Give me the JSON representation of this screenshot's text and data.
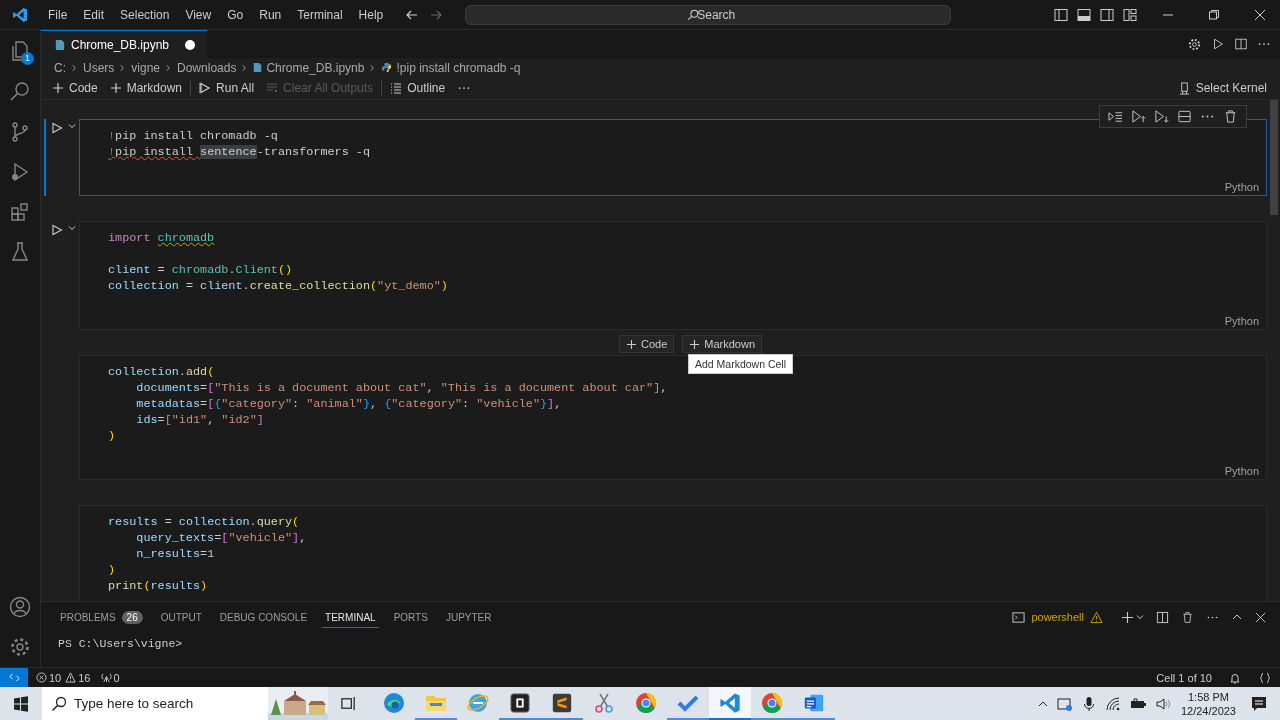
{
  "title_bar": {
    "menus": [
      "File",
      "Edit",
      "Selection",
      "View",
      "Go",
      "Run",
      "Terminal",
      "Help"
    ],
    "search": {
      "placeholder": "Search"
    }
  },
  "activity_bar": {
    "explorer_badge": "1"
  },
  "editor_tab": {
    "label": "Chrome_DB.ipynb",
    "dirty": true
  },
  "breadcrumb": [
    "C:",
    "Users",
    "vigne",
    "Downloads",
    "Chrome_DB.ipynb",
    "!pip install chromadb -q"
  ],
  "notebook_toolbar": {
    "items": [
      {
        "label": "Code",
        "kind": "plus",
        "disabled": false
      },
      {
        "label": "Markdown",
        "kind": "plus",
        "disabled": false
      },
      {
        "label": "Run All",
        "kind": "run",
        "disabled": false
      },
      {
        "label": "Clear All Outputs",
        "kind": "clear",
        "disabled": true
      },
      {
        "label": "Outline",
        "kind": "outline",
        "disabled": false
      }
    ],
    "kernel": "Select Kernel"
  },
  "cells": [
    {
      "selected": true,
      "run_visible": true,
      "language": "Python",
      "lines": [
        {
          "tokens": [
            {
              "text": "!",
              "kind": "bang"
            },
            {
              "text": "pip install chromadb -q",
              "kind": "plain"
            }
          ]
        },
        {
          "tokens": [
            {
              "text": "!",
              "kind": "bang_error"
            },
            {
              "text": "pip install ",
              "kind": "error"
            },
            {
              "text": "sentence",
              "kind": "highlight"
            },
            {
              "text": "-transformers -q",
              "kind": "plain"
            }
          ]
        }
      ]
    },
    {
      "selected": false,
      "run_visible": true,
      "language": "Python",
      "lines": [
        {
          "tokens": [
            {
              "text": "import ",
              "kind": "keyword"
            },
            {
              "text": "chromadb",
              "kind": "module_warning"
            }
          ]
        },
        {
          "blank_before": true,
          "tokens": [
            {
              "text": "client",
              "kind": "variable"
            },
            {
              "text": " = ",
              "kind": "plain"
            },
            {
              "text": "chromadb",
              "kind": "module"
            },
            {
              "text": ".",
              "kind": "plain"
            },
            {
              "text": "Client",
              "kind": "module"
            },
            {
              "text": "()",
              "kind": "bracket"
            }
          ]
        },
        {
          "tokens": [
            {
              "text": "collection",
              "kind": "variable"
            },
            {
              "text": " = ",
              "kind": "plain"
            },
            {
              "text": "client",
              "kind": "variable"
            },
            {
              "text": ".",
              "kind": "plain"
            },
            {
              "text": "create_collection",
              "kind": "function"
            },
            {
              "text": "(",
              "kind": "bracket"
            },
            {
              "text": "\"yt_demo\"",
              "kind": "string"
            },
            {
              "text": ")",
              "kind": "bracket"
            }
          ]
        }
      ]
    },
    {
      "selected": false,
      "run_visible": false,
      "language": "Python",
      "insert_above": {
        "buttons": [
          "Code",
          "Markdown"
        ],
        "tooltip": "Add Markdown Cell"
      },
      "lines": [
        {
          "tokens": [
            {
              "text": "collection",
              "kind": "variable"
            },
            {
              "text": ".",
              "kind": "plain"
            },
            {
              "text": "add",
              "kind": "function"
            },
            {
              "text": "(",
              "kind": "bracket"
            }
          ]
        },
        {
          "tokens": [
            {
              "text": "    documents",
              "kind": "variable"
            },
            {
              "text": "=",
              "kind": "plain"
            },
            {
              "text": "[",
              "kind": "bracket2"
            },
            {
              "text": "\"This is a document about cat\"",
              "kind": "string"
            },
            {
              "text": ", ",
              "kind": "plain"
            },
            {
              "text": "\"This is a document about car\"",
              "kind": "string"
            },
            {
              "text": "]",
              "kind": "bracket2"
            },
            {
              "text": ",",
              "kind": "plain"
            }
          ]
        },
        {
          "tokens": [
            {
              "text": "    metadatas",
              "kind": "variable"
            },
            {
              "text": "=",
              "kind": "plain"
            },
            {
              "text": "[",
              "kind": "bracket2"
            },
            {
              "text": "{",
              "kind": "bracket3"
            },
            {
              "text": "\"category\"",
              "kind": "string"
            },
            {
              "text": ": ",
              "kind": "plain"
            },
            {
              "text": "\"animal\"",
              "kind": "string"
            },
            {
              "text": "}",
              "kind": "bracket3"
            },
            {
              "text": ", ",
              "kind": "plain"
            },
            {
              "text": "{",
              "kind": "bracket3"
            },
            {
              "text": "\"category\"",
              "kind": "string"
            },
            {
              "text": ": ",
              "kind": "plain"
            },
            {
              "text": "\"vehicle\"",
              "kind": "string"
            },
            {
              "text": "}",
              "kind": "bracket3"
            },
            {
              "text": "]",
              "kind": "bracket2"
            },
            {
              "text": ",",
              "kind": "plain"
            }
          ]
        },
        {
          "tokens": [
            {
              "text": "    ids",
              "kind": "variable"
            },
            {
              "text": "=",
              "kind": "plain"
            },
            {
              "text": "[",
              "kind": "bracket2"
            },
            {
              "text": "\"id1\"",
              "kind": "string"
            },
            {
              "text": ", ",
              "kind": "plain"
            },
            {
              "text": "\"id2\"",
              "kind": "string"
            },
            {
              "text": "]",
              "kind": "bracket2"
            }
          ]
        },
        {
          "tokens": [
            {
              "text": ")",
              "kind": "bracket"
            }
          ]
        }
      ]
    },
    {
      "selected": false,
      "run_visible": false,
      "lines": [
        {
          "tokens": [
            {
              "text": "results",
              "kind": "variable"
            },
            {
              "text": " = ",
              "kind": "plain"
            },
            {
              "text": "collection",
              "kind": "variable"
            },
            {
              "text": ".",
              "kind": "plain"
            },
            {
              "text": "query",
              "kind": "function"
            },
            {
              "text": "(",
              "kind": "bracket"
            }
          ]
        },
        {
          "tokens": [
            {
              "text": "    query_texts",
              "kind": "variable"
            },
            {
              "text": "=",
              "kind": "plain"
            },
            {
              "text": "[",
              "kind": "bracket2"
            },
            {
              "text": "\"vehicle\"",
              "kind": "string"
            },
            {
              "text": "]",
              "kind": "bracket2"
            },
            {
              "text": ",",
              "kind": "plain"
            }
          ]
        },
        {
          "tokens": [
            {
              "text": "    n_results",
              "kind": "variable"
            },
            {
              "text": "=",
              "kind": "plain"
            },
            {
              "text": "1",
              "kind": "number"
            }
          ]
        },
        {
          "tokens": [
            {
              "text": ")",
              "kind": "bracket"
            }
          ]
        },
        {
          "tokens": [
            {
              "text": "print",
              "kind": "function"
            },
            {
              "text": "(",
              "kind": "bracket"
            },
            {
              "text": "results",
              "kind": "variable"
            },
            {
              "text": ")",
              "kind": "bracket"
            }
          ]
        }
      ]
    }
  ],
  "panel": {
    "tabs": [
      {
        "label": "PROBLEMS",
        "badge": "26",
        "selected": false
      },
      {
        "label": "OUTPUT",
        "selected": false
      },
      {
        "label": "DEBUG CONSOLE",
        "selected": false
      },
      {
        "label": "TERMINAL",
        "selected": true
      },
      {
        "label": "PORTS",
        "selected": false
      },
      {
        "label": "JUPYTER",
        "selected": false
      }
    ],
    "terminal_name": "powershell",
    "terminal_text": "PS C:\\Users\\vigne>"
  },
  "status_bar": {
    "errors": "10",
    "warnings": "16",
    "ports": "0",
    "cell_position": "Cell 1 of 10"
  },
  "taskbar": {
    "search": {
      "placeholder": "Type here to search"
    },
    "apps": [
      {
        "kind": "swirl",
        "running": false,
        "active": false
      },
      {
        "kind": "folder",
        "running": true,
        "active": false
      },
      {
        "kind": "globe",
        "running": false,
        "active": false
      },
      {
        "kind": "darktile",
        "running": true,
        "active": false
      },
      {
        "kind": "chevrontile",
        "running": true,
        "active": false
      },
      {
        "kind": "scissors",
        "running": false,
        "active": false
      },
      {
        "kind": "ring",
        "running": false,
        "active": false
      },
      {
        "kind": "check",
        "running": true,
        "active": false
      },
      {
        "kind": "ribbon",
        "running": true,
        "active": true
      },
      {
        "kind": "ring",
        "running": true,
        "active": false
      },
      {
        "kind": "doctile",
        "running": true,
        "active": false
      }
    ],
    "time": "1:58 PM",
    "date": "12/24/2023"
  }
}
